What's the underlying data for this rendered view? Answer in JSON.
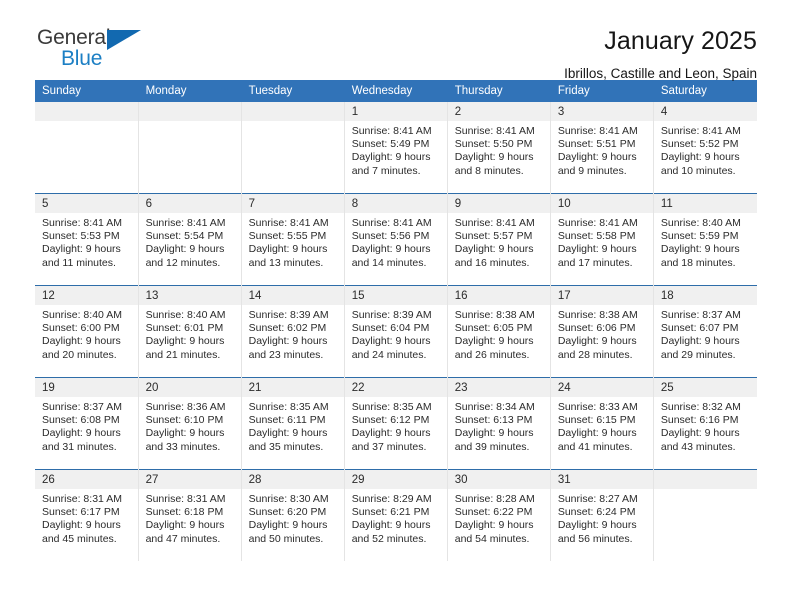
{
  "brand": {
    "name_part1": "General",
    "name_part2": "Blue",
    "triangle_icon": "triangle-icon",
    "colors": {
      "dark": "#3a3a3a",
      "blue": "#1c7fc4",
      "triangle": "#1269b0"
    }
  },
  "header": {
    "title": "January 2025",
    "subtitle": "Ibrillos, Castille and Leon, Spain"
  },
  "theme": {
    "header_blue": "#3173b8",
    "week_separator_blue": "#2e6da9",
    "daynum_band": "#f0f0f0",
    "cell_divider": "#e4e4e4"
  },
  "weekday_headers": [
    "Sunday",
    "Monday",
    "Tuesday",
    "Wednesday",
    "Thursday",
    "Friday",
    "Saturday"
  ],
  "weeks": [
    [
      {
        "empty": true
      },
      {
        "empty": true
      },
      {
        "empty": true
      },
      {
        "day": "1",
        "sunrise": "Sunrise: 8:41 AM",
        "sunset": "Sunset: 5:49 PM",
        "daylight": "Daylight: 9 hours and 7 minutes."
      },
      {
        "day": "2",
        "sunrise": "Sunrise: 8:41 AM",
        "sunset": "Sunset: 5:50 PM",
        "daylight": "Daylight: 9 hours and 8 minutes."
      },
      {
        "day": "3",
        "sunrise": "Sunrise: 8:41 AM",
        "sunset": "Sunset: 5:51 PM",
        "daylight": "Daylight: 9 hours and 9 minutes."
      },
      {
        "day": "4",
        "sunrise": "Sunrise: 8:41 AM",
        "sunset": "Sunset: 5:52 PM",
        "daylight": "Daylight: 9 hours and 10 minutes."
      }
    ],
    [
      {
        "day": "5",
        "sunrise": "Sunrise: 8:41 AM",
        "sunset": "Sunset: 5:53 PM",
        "daylight": "Daylight: 9 hours and 11 minutes."
      },
      {
        "day": "6",
        "sunrise": "Sunrise: 8:41 AM",
        "sunset": "Sunset: 5:54 PM",
        "daylight": "Daylight: 9 hours and 12 minutes."
      },
      {
        "day": "7",
        "sunrise": "Sunrise: 8:41 AM",
        "sunset": "Sunset: 5:55 PM",
        "daylight": "Daylight: 9 hours and 13 minutes."
      },
      {
        "day": "8",
        "sunrise": "Sunrise: 8:41 AM",
        "sunset": "Sunset: 5:56 PM",
        "daylight": "Daylight: 9 hours and 14 minutes."
      },
      {
        "day": "9",
        "sunrise": "Sunrise: 8:41 AM",
        "sunset": "Sunset: 5:57 PM",
        "daylight": "Daylight: 9 hours and 16 minutes."
      },
      {
        "day": "10",
        "sunrise": "Sunrise: 8:41 AM",
        "sunset": "Sunset: 5:58 PM",
        "daylight": "Daylight: 9 hours and 17 minutes."
      },
      {
        "day": "11",
        "sunrise": "Sunrise: 8:40 AM",
        "sunset": "Sunset: 5:59 PM",
        "daylight": "Daylight: 9 hours and 18 minutes."
      }
    ],
    [
      {
        "day": "12",
        "sunrise": "Sunrise: 8:40 AM",
        "sunset": "Sunset: 6:00 PM",
        "daylight": "Daylight: 9 hours and 20 minutes."
      },
      {
        "day": "13",
        "sunrise": "Sunrise: 8:40 AM",
        "sunset": "Sunset: 6:01 PM",
        "daylight": "Daylight: 9 hours and 21 minutes."
      },
      {
        "day": "14",
        "sunrise": "Sunrise: 8:39 AM",
        "sunset": "Sunset: 6:02 PM",
        "daylight": "Daylight: 9 hours and 23 minutes."
      },
      {
        "day": "15",
        "sunrise": "Sunrise: 8:39 AM",
        "sunset": "Sunset: 6:04 PM",
        "daylight": "Daylight: 9 hours and 24 minutes."
      },
      {
        "day": "16",
        "sunrise": "Sunrise: 8:38 AM",
        "sunset": "Sunset: 6:05 PM",
        "daylight": "Daylight: 9 hours and 26 minutes."
      },
      {
        "day": "17",
        "sunrise": "Sunrise: 8:38 AM",
        "sunset": "Sunset: 6:06 PM",
        "daylight": "Daylight: 9 hours and 28 minutes."
      },
      {
        "day": "18",
        "sunrise": "Sunrise: 8:37 AM",
        "sunset": "Sunset: 6:07 PM",
        "daylight": "Daylight: 9 hours and 29 minutes."
      }
    ],
    [
      {
        "day": "19",
        "sunrise": "Sunrise: 8:37 AM",
        "sunset": "Sunset: 6:08 PM",
        "daylight": "Daylight: 9 hours and 31 minutes."
      },
      {
        "day": "20",
        "sunrise": "Sunrise: 8:36 AM",
        "sunset": "Sunset: 6:10 PM",
        "daylight": "Daylight: 9 hours and 33 minutes."
      },
      {
        "day": "21",
        "sunrise": "Sunrise: 8:35 AM",
        "sunset": "Sunset: 6:11 PM",
        "daylight": "Daylight: 9 hours and 35 minutes."
      },
      {
        "day": "22",
        "sunrise": "Sunrise: 8:35 AM",
        "sunset": "Sunset: 6:12 PM",
        "daylight": "Daylight: 9 hours and 37 minutes."
      },
      {
        "day": "23",
        "sunrise": "Sunrise: 8:34 AM",
        "sunset": "Sunset: 6:13 PM",
        "daylight": "Daylight: 9 hours and 39 minutes."
      },
      {
        "day": "24",
        "sunrise": "Sunrise: 8:33 AM",
        "sunset": "Sunset: 6:15 PM",
        "daylight": "Daylight: 9 hours and 41 minutes."
      },
      {
        "day": "25",
        "sunrise": "Sunrise: 8:32 AM",
        "sunset": "Sunset: 6:16 PM",
        "daylight": "Daylight: 9 hours and 43 minutes."
      }
    ],
    [
      {
        "day": "26",
        "sunrise": "Sunrise: 8:31 AM",
        "sunset": "Sunset: 6:17 PM",
        "daylight": "Daylight: 9 hours and 45 minutes."
      },
      {
        "day": "27",
        "sunrise": "Sunrise: 8:31 AM",
        "sunset": "Sunset: 6:18 PM",
        "daylight": "Daylight: 9 hours and 47 minutes."
      },
      {
        "day": "28",
        "sunrise": "Sunrise: 8:30 AM",
        "sunset": "Sunset: 6:20 PM",
        "daylight": "Daylight: 9 hours and 50 minutes."
      },
      {
        "day": "29",
        "sunrise": "Sunrise: 8:29 AM",
        "sunset": "Sunset: 6:21 PM",
        "daylight": "Daylight: 9 hours and 52 minutes."
      },
      {
        "day": "30",
        "sunrise": "Sunrise: 8:28 AM",
        "sunset": "Sunset: 6:22 PM",
        "daylight": "Daylight: 9 hours and 54 minutes."
      },
      {
        "day": "31",
        "sunrise": "Sunrise: 8:27 AM",
        "sunset": "Sunset: 6:24 PM",
        "daylight": "Daylight: 9 hours and 56 minutes."
      },
      {
        "empty": true
      }
    ]
  ]
}
